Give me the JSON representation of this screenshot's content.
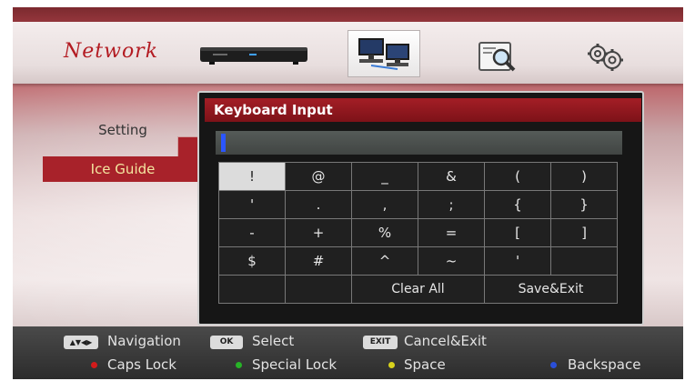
{
  "app_title": "Network",
  "top_icons": [
    "set-top-box-icon",
    "network-computers-icon",
    "search-magnifier-icon",
    "gears-icon"
  ],
  "sidebar": {
    "items": [
      {
        "label": "Setting"
      },
      {
        "label": "Ice Guide"
      }
    ]
  },
  "keyboard": {
    "title": "Keyboard Input",
    "input_value": "",
    "rows": [
      [
        "!",
        "@",
        "_",
        "&",
        "(",
        ")"
      ],
      [
        "'",
        ".",
        ",",
        ";",
        "{",
        "}"
      ],
      [
        "-",
        "+",
        "%",
        "=",
        "[",
        "]"
      ],
      [
        "$",
        "#",
        "^",
        "~",
        "'",
        ""
      ]
    ],
    "actions": {
      "clear_all": "Clear All",
      "save_exit": "Save&Exit"
    }
  },
  "hints": {
    "nav_key": "▲▼◀▶",
    "navigation": "Navigation",
    "ok_key": "OK",
    "select": "Select",
    "exit_key": "EXIT",
    "cancel_exit": "Cancel&Exit",
    "caps_lock": "Caps Lock",
    "special_lock": "Special Lock",
    "space": "Space",
    "backspace": "Backspace"
  },
  "colors": {
    "red": "#d31b1b",
    "green": "#27b327",
    "yellow": "#d8d21c",
    "blue": "#2a4fd8",
    "accent": "#a8222a"
  }
}
